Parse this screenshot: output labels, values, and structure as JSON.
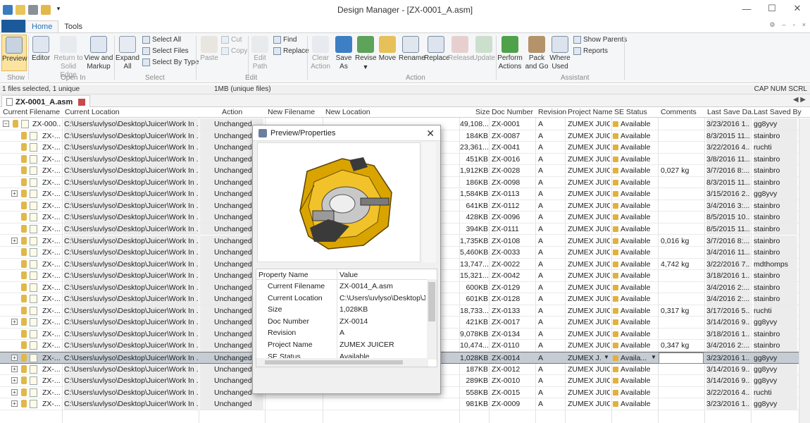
{
  "window": {
    "title": "Design Manager - [ZX-0001_A.asm]",
    "minimize": "—",
    "maximize": "☐",
    "close": "✕"
  },
  "menu": {
    "tabs": [
      "Home",
      "Tools"
    ],
    "help_icon": "help-icon"
  },
  "ribbon": {
    "preview": "Preview",
    "editor": "Editor",
    "return_to": "Return to",
    "solid_edge": "Solid Edge",
    "view_and": "View and",
    "markup": "Markup",
    "expand": "Expand",
    "all": "All",
    "select_all": "Select All",
    "select_files": "Select Files",
    "select_by_type": "Select By Type",
    "paste": "Paste",
    "cut": "Cut",
    "copy": "Copy",
    "edit": "Edit",
    "path": "Path",
    "find": "Find",
    "replace_small": "Replace",
    "clear": "Clear",
    "action_label": "Action",
    "save": "Save",
    "as": "As",
    "revise": "Revise",
    "move": "Move",
    "rename": "Rename",
    "replace": "Replace",
    "release": "Release",
    "update": "Update",
    "perform": "Perform",
    "actions": "Actions",
    "pack": "Pack",
    "and_go": "and Go",
    "where": "Where",
    "used": "Used",
    "show_parents": "Show Parents",
    "reports": "Reports",
    "groups": [
      "Show",
      "Open In",
      "Select",
      "Edit",
      "Action",
      "Assistant"
    ]
  },
  "status": {
    "selection": "1 files selected, 1 unique",
    "size": "1MB (unique files)",
    "keys": "CAP NUM SCRL"
  },
  "doc_tab": {
    "label": "ZX-0001_A.asm"
  },
  "columns": [
    "Current Filename",
    "Current Location",
    "Action",
    "New Filename",
    "New Location",
    "Size",
    "Doc Number",
    "Revision",
    "Project Name",
    "SE Status",
    "Comments",
    "Last Save Da...",
    "Last Saved By"
  ],
  "rows": [
    {
      "name": "ZX-000...",
      "loc": "C:\\Users\\uvlyso\\Desktop\\Juicer\\Work In ...",
      "action": "Unchanged",
      "size": "49,108...",
      "doc": "ZX-0001",
      "rev": "A",
      "proj": "ZUMEX JUIC...",
      "status": "Available",
      "comments": "",
      "date": "3/23/2016 1...",
      "by": "gg8yvy",
      "exp": "−"
    },
    {
      "name": "ZX-...",
      "loc": "C:\\Users\\uvlyso\\Desktop\\Juicer\\Work In ...",
      "action": "Unchanged",
      "size": "184KB",
      "doc": "ZX-0087",
      "rev": "A",
      "proj": "ZUMEX JUIC...",
      "status": "Available",
      "comments": "",
      "date": "8/3/2015 11...",
      "by": "stainbro",
      "exp": ""
    },
    {
      "name": "ZX-...",
      "loc": "C:\\Users\\uvlyso\\Desktop\\Juicer\\Work In ...",
      "action": "Unchanged",
      "size": "23,361...",
      "doc": "ZX-0041",
      "rev": "A",
      "proj": "ZUMEX JUIC...",
      "status": "Available",
      "comments": "",
      "date": "3/22/2016 4...",
      "by": "ruchti",
      "exp": ""
    },
    {
      "name": "ZX-...",
      "loc": "C:\\Users\\uvlyso\\Desktop\\Juicer\\Work In ...",
      "action": "Unchanged",
      "size": "451KB",
      "doc": "ZX-0016",
      "rev": "A",
      "proj": "ZUMEX JUIC...",
      "status": "Available",
      "comments": "",
      "date": "3/8/2016 11...",
      "by": "stainbro",
      "exp": ""
    },
    {
      "name": "ZX-...",
      "loc": "C:\\Users\\uvlyso\\Desktop\\Juicer\\Work In ...",
      "action": "Unchanged",
      "size": "1,912KB",
      "doc": "ZX-0028",
      "rev": "A",
      "proj": "ZUMEX JUIC...",
      "status": "Available",
      "comments": "0,027 kg",
      "date": "3/7/2016 8:...",
      "by": "stainbro",
      "exp": ""
    },
    {
      "name": "ZX-...",
      "loc": "C:\\Users\\uvlyso\\Desktop\\Juicer\\Work In ...",
      "action": "Unchanged",
      "size": "186KB",
      "doc": "ZX-0098",
      "rev": "A",
      "proj": "ZUMEX JUIC...",
      "status": "Available",
      "comments": "",
      "date": "8/3/2015 11...",
      "by": "stainbro",
      "exp": ""
    },
    {
      "name": "ZX-...",
      "loc": "C:\\Users\\uvlyso\\Desktop\\Juicer\\Work In ...",
      "action": "Unchanged",
      "size": "1,584KB",
      "doc": "ZX-0113",
      "rev": "A",
      "proj": "ZUMEX JUIC...",
      "status": "Available",
      "comments": "",
      "date": "3/15/2016 2...",
      "by": "gg8yvy",
      "exp": "+"
    },
    {
      "name": "ZX-...",
      "loc": "C:\\Users\\uvlyso\\Desktop\\Juicer\\Work In ...",
      "action": "Unchanged",
      "size": "641KB",
      "doc": "ZX-0112",
      "rev": "A",
      "proj": "ZUMEX JUIC...",
      "status": "Available",
      "comments": "",
      "date": "3/4/2016 3:...",
      "by": "stainbro",
      "exp": ""
    },
    {
      "name": "ZX-...",
      "loc": "C:\\Users\\uvlyso\\Desktop\\Juicer\\Work In ...",
      "action": "Unchanged",
      "size": "428KB",
      "doc": "ZX-0096",
      "rev": "A",
      "proj": "ZUMEX JUIC...",
      "status": "Available",
      "comments": "",
      "date": "8/5/2015 10...",
      "by": "stainbro",
      "exp": ""
    },
    {
      "name": "ZX-...",
      "loc": "C:\\Users\\uvlyso\\Desktop\\Juicer\\Work In ...",
      "action": "Unchanged",
      "size": "394KB",
      "doc": "ZX-0111",
      "rev": "A",
      "proj": "ZUMEX JUIC...",
      "status": "Available",
      "comments": "",
      "date": "8/5/2015 11...",
      "by": "stainbro",
      "exp": ""
    },
    {
      "name": "ZX-...",
      "loc": "C:\\Users\\uvlyso\\Desktop\\Juicer\\Work In ...",
      "action": "Unchanged",
      "size": "1,735KB",
      "doc": "ZX-0108",
      "rev": "A",
      "proj": "ZUMEX JUIC...",
      "status": "Available",
      "comments": "0,016 kg",
      "date": "3/7/2016 8:...",
      "by": "stainbro",
      "exp": "+"
    },
    {
      "name": "ZX-...",
      "loc": "C:\\Users\\uvlyso\\Desktop\\Juicer\\Work In ...",
      "action": "Unchanged",
      "size": "5,460KB",
      "doc": "ZX-0033",
      "rev": "A",
      "proj": "ZUMEX JUIC...",
      "status": "Available",
      "comments": "",
      "date": "3/4/2016 11...",
      "by": "stainbro",
      "exp": ""
    },
    {
      "name": "ZX-...",
      "loc": "C:\\Users\\uvlyso\\Desktop\\Juicer\\Work In ...",
      "action": "Unchanged",
      "size": "13,747...",
      "doc": "ZX-0022",
      "rev": "A",
      "proj": "ZUMEX JUIC...",
      "status": "Available",
      "comments": "4,742 kg",
      "date": "3/22/2016 7...",
      "by": "mdthomps",
      "exp": ""
    },
    {
      "name": "ZX-...",
      "loc": "C:\\Users\\uvlyso\\Desktop\\Juicer\\Work In ...",
      "action": "Unchanged",
      "size": "15,321...",
      "doc": "ZX-0042",
      "rev": "A",
      "proj": "ZUMEX JUIC...",
      "status": "Available",
      "comments": "",
      "date": "3/18/2016 1...",
      "by": "stainbro",
      "exp": ""
    },
    {
      "name": "ZX-...",
      "loc": "C:\\Users\\uvlyso\\Desktop\\Juicer\\Work In ...",
      "action": "Unchanged",
      "size": "600KB",
      "doc": "ZX-0129",
      "rev": "A",
      "proj": "ZUMEX JUIC...",
      "status": "Available",
      "comments": "",
      "date": "3/4/2016 2:...",
      "by": "stainbro",
      "exp": ""
    },
    {
      "name": "ZX-...",
      "loc": "C:\\Users\\uvlyso\\Desktop\\Juicer\\Work In ...",
      "action": "Unchanged",
      "size": "601KB",
      "doc": "ZX-0128",
      "rev": "A",
      "proj": "ZUMEX JUIC...",
      "status": "Available",
      "comments": "",
      "date": "3/4/2016 2:...",
      "by": "stainbro",
      "exp": ""
    },
    {
      "name": "ZX-...",
      "loc": "C:\\Users\\uvlyso\\Desktop\\Juicer\\Work In ...",
      "action": "Unchanged",
      "size": "18,733...",
      "doc": "ZX-0133",
      "rev": "A",
      "proj": "ZUMEX JUIC...",
      "status": "Available",
      "comments": "0,317 kg",
      "date": "3/17/2016 5...",
      "by": "ruchti",
      "exp": ""
    },
    {
      "name": "ZX-...",
      "loc": "C:\\Users\\uvlyso\\Desktop\\Juicer\\Work In ...",
      "action": "Unchanged",
      "size": "421KB",
      "doc": "ZX-0017",
      "rev": "A",
      "proj": "ZUMEX JUIC...",
      "status": "Available",
      "comments": "",
      "date": "3/14/2016 9...",
      "by": "gg8yvy",
      "exp": "+"
    },
    {
      "name": "ZX-...",
      "loc": "C:\\Users\\uvlyso\\Desktop\\Juicer\\Work In ...",
      "action": "Unchanged",
      "size": "9,078KB",
      "doc": "ZX-0134",
      "rev": "A",
      "proj": "ZUMEX JUIC...",
      "status": "Available",
      "comments": "",
      "date": "3/18/2016 1...",
      "by": "stainbro",
      "exp": ""
    },
    {
      "name": "ZX-...",
      "loc": "C:\\Users\\uvlyso\\Desktop\\Juicer\\Work In ...",
      "action": "Unchanged",
      "size": "10,474...",
      "doc": "ZX-0110",
      "rev": "A",
      "proj": "ZUMEX JUIC...",
      "status": "Available",
      "comments": "0,347 kg",
      "date": "3/4/2016 2:...",
      "by": "stainbro",
      "exp": ""
    },
    {
      "name": "ZX-...",
      "loc": "C:\\Users\\uvlyso\\Desktop\\Juicer\\Work In ...",
      "action": "Unchanged",
      "size": "1,028KB",
      "doc": "ZX-0014",
      "rev": "A",
      "proj": "ZUMEX J...",
      "status": "Availa...",
      "comments": "",
      "date": "3/23/2016 1...",
      "by": "gg8yvy",
      "exp": "+",
      "selected": true
    },
    {
      "name": "ZX-...",
      "loc": "C:\\Users\\uvlyso\\Desktop\\Juicer\\Work In ...",
      "action": "Unchanged",
      "size": "187KB",
      "doc": "ZX-0012",
      "rev": "A",
      "proj": "ZUMEX JUIC...",
      "status": "Available",
      "comments": "",
      "date": "3/14/2016 9...",
      "by": "gg8yvy",
      "exp": "+"
    },
    {
      "name": "ZX-...",
      "loc": "C:\\Users\\uvlyso\\Desktop\\Juicer\\Work In ...",
      "action": "Unchanged",
      "size": "289KB",
      "doc": "ZX-0010",
      "rev": "A",
      "proj": "ZUMEX JUIC...",
      "status": "Available",
      "comments": "",
      "date": "3/14/2016 9...",
      "by": "gg8yvy",
      "exp": "+"
    },
    {
      "name": "ZX-...",
      "loc": "C:\\Users\\uvlyso\\Desktop\\Juicer\\Work In ...",
      "action": "Unchanged",
      "size": "558KB",
      "doc": "ZX-0015",
      "rev": "A",
      "proj": "ZUMEX JUIC...",
      "status": "Available",
      "comments": "",
      "date": "3/22/2016 4...",
      "by": "ruchti",
      "exp": "+"
    },
    {
      "name": "ZX-...",
      "loc": "C:\\Users\\uvlyso\\Desktop\\Juicer\\Work In ...",
      "action": "Unchanged",
      "size": "981KB",
      "doc": "ZX-0009",
      "rev": "A",
      "proj": "ZUMEX JUIC...",
      "status": "Available",
      "comments": "",
      "date": "3/23/2016 1...",
      "by": "gg8yvy",
      "exp": "+"
    }
  ],
  "dialog": {
    "title": "Preview/Properties",
    "close": "✕",
    "col_name": "Property Name",
    "col_value": "Value",
    "props": [
      {
        "name": "Current Filename",
        "value": "ZX-0014_A.asm"
      },
      {
        "name": "Current Location",
        "value": "C:\\Users\\uvlyso\\Desktop\\J..."
      },
      {
        "name": "Size",
        "value": "1,028KB"
      },
      {
        "name": "Doc Number",
        "value": "ZX-0014"
      },
      {
        "name": "Revision",
        "value": "A"
      },
      {
        "name": "Project Name",
        "value": "ZUMEX JUICER"
      },
      {
        "name": "SE Status",
        "value": "Available"
      }
    ]
  },
  "colors": {
    "accent": "#2a6fb5",
    "selected_row": "#c6ccd3",
    "model_gold": "#d9a400"
  }
}
